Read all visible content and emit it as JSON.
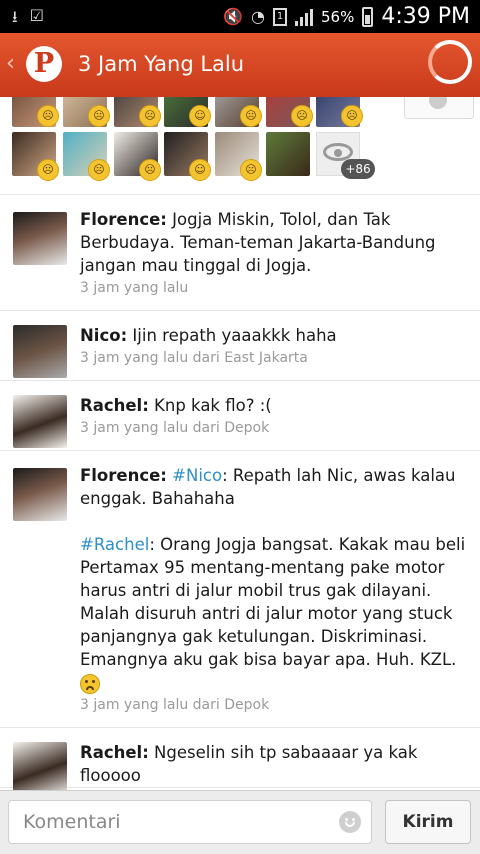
{
  "status_bar": {
    "battery": "56%",
    "time": "4:39 PM",
    "icons": [
      "download-icon",
      "clipboard-check-icon",
      "mute-icon",
      "wifi-icon",
      "sim-icon",
      "signal-icon",
      "battery-icon"
    ]
  },
  "header": {
    "app_logo": "P",
    "title": "3 Jam Yang Lalu"
  },
  "viewers": {
    "more_count": "+86"
  },
  "comments": [
    {
      "name": "Florence:",
      "text": " Jogja Miskin, Tolol, dan Tak Berbudaya. Teman-teman Jakarta-Bandung jangan mau tinggal di Jogja.",
      "meta": "3 jam yang lalu"
    },
    {
      "name": "Nico:",
      "text": " Ijin repath yaaakkk haha",
      "meta": "3 jam yang lalu dari East Jakarta"
    },
    {
      "name": "Rachel:",
      "text": " Knp kak flo? :(",
      "meta": "3 jam yang lalu dari Depok"
    },
    {
      "name": "Florence:",
      "mention1": "#Nico",
      "text": ": Repath lah Nic, awas kalau enggak. Bahahaha",
      "mention2": "#Rachel",
      "text2": ": Orang Jogja bangsat. Kakak mau beli Pertamax 95 mentang-mentang pake motor harus antri di jalur mobil trus gak dilayani. Malah disuruh antri di jalur motor yang stuck panjangnya gak ketulungan. Diskriminasi. Emangnya aku gak bisa bayar apa. Huh. KZL.",
      "meta": "3 jam yang lalu dari Depok"
    },
    {
      "name": "Rachel:",
      "text": " Ngeselin sih tp sabaaaar ya kak flooooo"
    }
  ],
  "composer": {
    "placeholder": "Komentari",
    "send_label": "Kirim"
  },
  "colors": {
    "brand": "#d9451f",
    "mention": "#2f8fc9"
  }
}
